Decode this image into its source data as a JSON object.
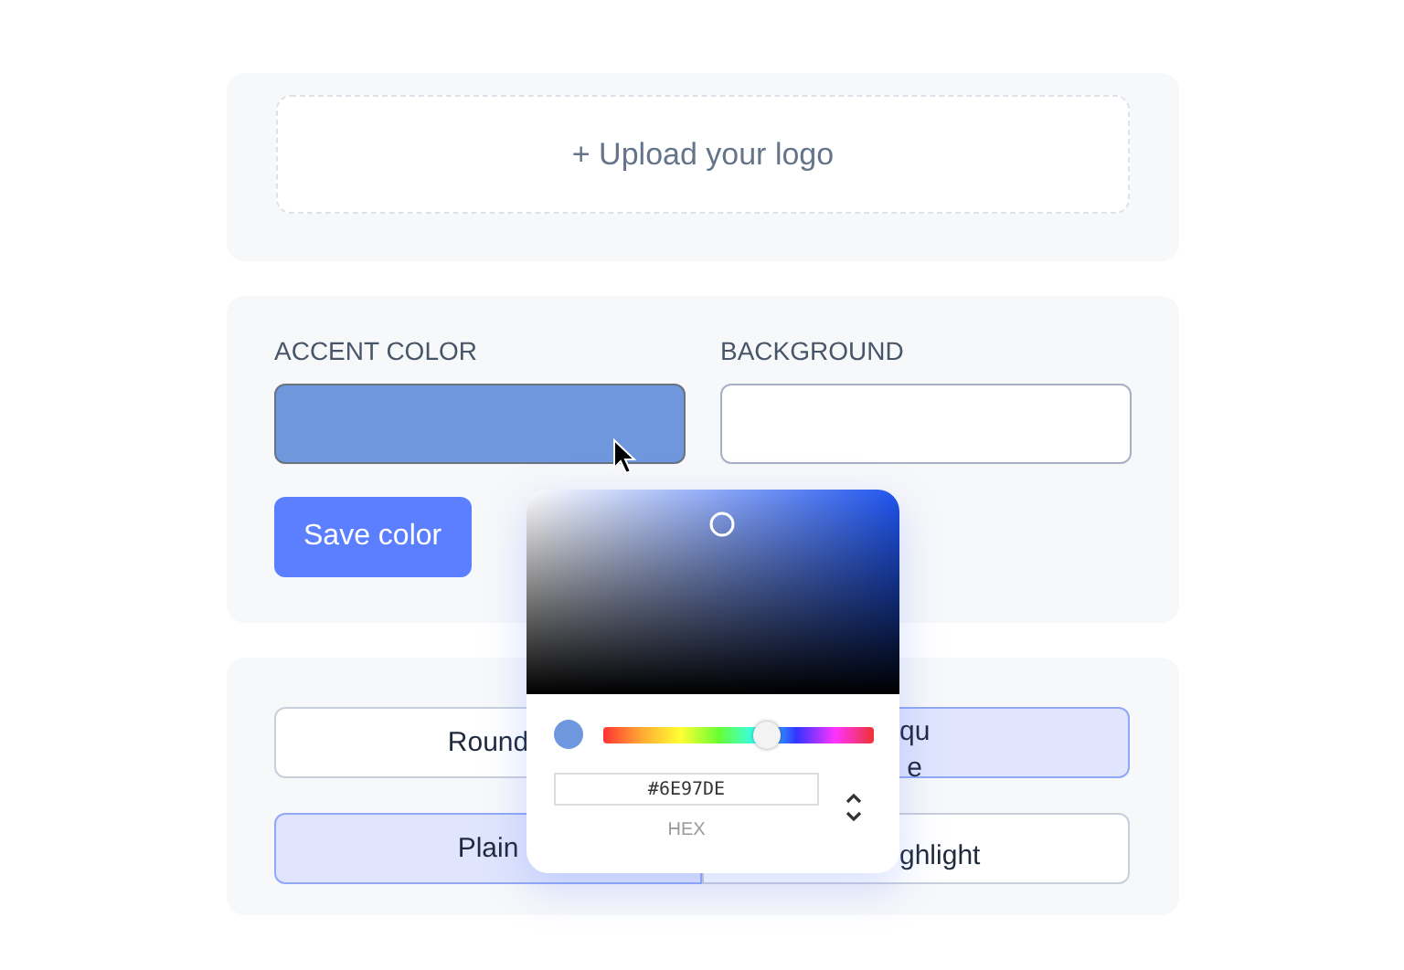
{
  "upload": {
    "label": "+ Upload your logo"
  },
  "colors": {
    "fields": [
      {
        "label": "ACCENT COLOR",
        "color": "#6e97de"
      },
      {
        "label": "BACKGROUND",
        "color": "#ffffff"
      }
    ],
    "save_button": "Save color"
  },
  "options": [
    {
      "label": "Round",
      "selected": false
    },
    {
      "label": "qu\ne",
      "selected": true
    },
    {
      "label": "Plain",
      "selected": true
    },
    {
      "label": "ghlight",
      "selected": false
    }
  ],
  "picker": {
    "swatch": {
      "color": "#6e97de"
    },
    "hue_slider": {
      "level": 0.6
    },
    "hex": "#6E97DE",
    "format": "HEX"
  }
}
